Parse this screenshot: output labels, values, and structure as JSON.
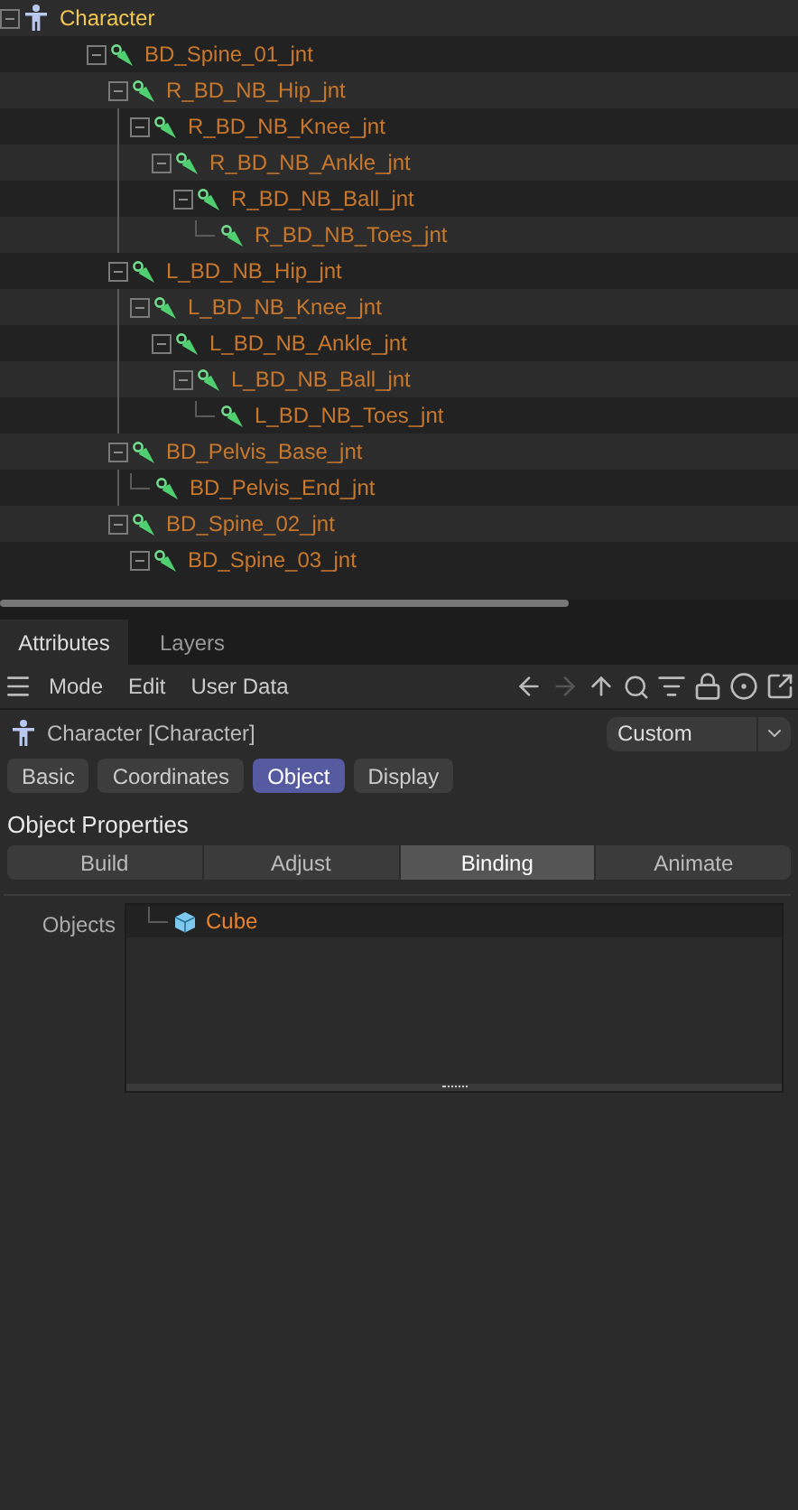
{
  "tree": [
    {
      "label": "Character",
      "kind": "character",
      "expanded": true,
      "children": [
        {
          "label": "BD_Spine_01_jnt",
          "kind": "joint",
          "expanded": true,
          "children": [
            {
              "label": "R_BD_NB_Hip_jnt",
              "kind": "joint",
              "expanded": true,
              "children": [
                {
                  "label": "R_BD_NB_Knee_jnt",
                  "kind": "joint",
                  "expanded": true,
                  "children": [
                    {
                      "label": "R_BD_NB_Ankle_jnt",
                      "kind": "joint",
                      "expanded": true,
                      "children": [
                        {
                          "label": "R_BD_NB_Ball_jnt",
                          "kind": "joint",
                          "expanded": true,
                          "children": [
                            {
                              "label": "R_BD_NB_Toes_jnt",
                              "kind": "joint"
                            }
                          ]
                        }
                      ]
                    }
                  ]
                }
              ]
            },
            {
              "label": "L_BD_NB_Hip_jnt",
              "kind": "joint",
              "expanded": true,
              "children": [
                {
                  "label": "L_BD_NB_Knee_jnt",
                  "kind": "joint",
                  "expanded": true,
                  "children": [
                    {
                      "label": "L_BD_NB_Ankle_jnt",
                      "kind": "joint",
                      "expanded": true,
                      "children": [
                        {
                          "label": "L_BD_NB_Ball_jnt",
                          "kind": "joint",
                          "expanded": true,
                          "children": [
                            {
                              "label": "L_BD_NB_Toes_jnt",
                              "kind": "joint"
                            }
                          ]
                        }
                      ]
                    }
                  ]
                }
              ]
            },
            {
              "label": "BD_Pelvis_Base_jnt",
              "kind": "joint",
              "expanded": true,
              "children": [
                {
                  "label": "BD_Pelvis_End_jnt",
                  "kind": "joint"
                }
              ]
            },
            {
              "label": "BD_Spine_02_jnt",
              "kind": "joint",
              "expanded": true,
              "children": [
                {
                  "label": "BD_Spine_03_jnt",
                  "kind": "joint",
                  "expanded": true
                }
              ]
            }
          ]
        }
      ]
    }
  ],
  "panel_tabs": [
    {
      "label": "Attributes",
      "selected": true
    },
    {
      "label": "Layers",
      "selected": false
    }
  ],
  "menu": [
    "Mode",
    "Edit",
    "User Data"
  ],
  "nav": {
    "forward_disabled": true
  },
  "object": {
    "title": "Character [Character]",
    "preset": "Custom"
  },
  "tabs": [
    {
      "label": "Basic",
      "selected": false
    },
    {
      "label": "Coordinates",
      "selected": false
    },
    {
      "label": "Object",
      "selected": true
    },
    {
      "label": "Display",
      "selected": false
    }
  ],
  "section_title": "Object Properties",
  "segments": [
    {
      "label": "Build",
      "selected": false
    },
    {
      "label": "Adjust",
      "selected": false
    },
    {
      "label": "Binding",
      "selected": true
    },
    {
      "label": "Animate",
      "selected": false
    }
  ],
  "objects_field": {
    "label": "Objects",
    "items": [
      {
        "label": "Cube",
        "kind": "cube"
      }
    ]
  }
}
